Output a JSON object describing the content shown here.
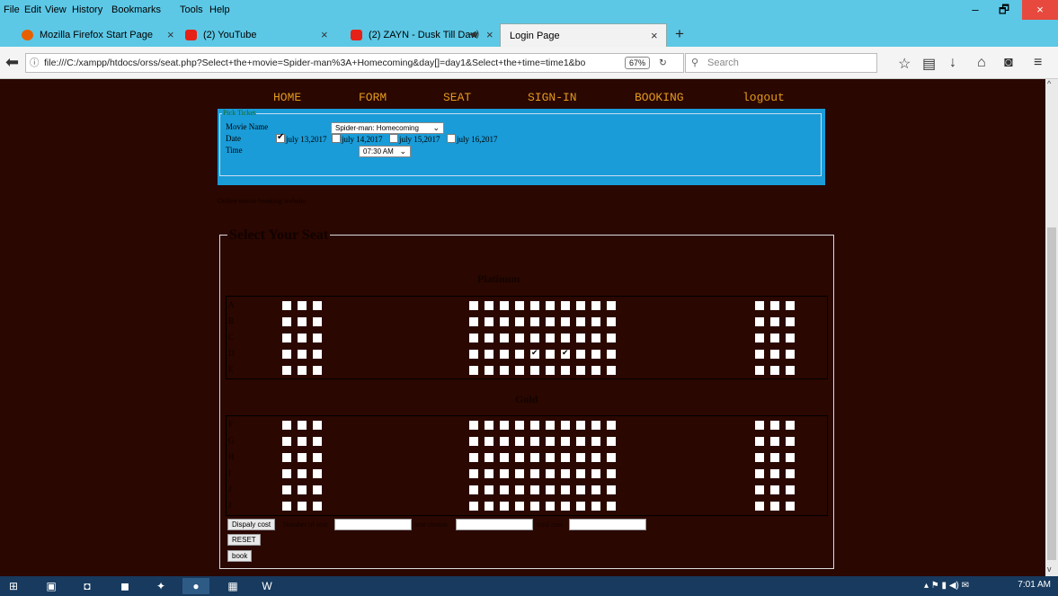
{
  "menu": [
    "File",
    "Edit",
    "View",
    "History",
    "Bookmarks",
    "Tools",
    "Help"
  ],
  "tabs": [
    {
      "label": "Mozilla Firefox Start Page"
    },
    {
      "label": "(2) YouTube"
    },
    {
      "label": "(2) ZAYN - Dusk Till Daw"
    },
    {
      "label": "Login Page"
    }
  ],
  "window_controls": {
    "minimize": "–",
    "restore": "🗗",
    "close": "×"
  },
  "navbar": {
    "url": "file:///C:/xampp/htdocs/orss/seat.php?Select+the+movie=Spider-man%3A+Homecoming&day[]=day1&Select+the+time=time1&bo",
    "zoom": "67%",
    "search_placeholder": "Search"
  },
  "site_nav": [
    "HOME",
    "FORM",
    "SEAT",
    "SIGN-IN",
    "BOOKING",
    "logout"
  ],
  "pick": {
    "legend": "Pick Ticket",
    "movie_label": "Movie Name",
    "movie_value": "Spider-man: Homecoming",
    "date_label": "Date",
    "dates": [
      {
        "label": "july 13,2017",
        "checked": true
      },
      {
        "label": "july 14,2017",
        "checked": false
      },
      {
        "label": "july 15,2017",
        "checked": false
      },
      {
        "label": "july 16,2017",
        "checked": false
      }
    ],
    "time_label": "Time",
    "time_value": "07:30 AM"
  },
  "footer_text": "Online movie booking website",
  "seats": {
    "legend": "Select Your Seat",
    "sections": [
      {
        "title": "Platinum",
        "rows": [
          "A",
          "B",
          "C",
          "D",
          "E"
        ]
      },
      {
        "title": "Gold",
        "rows": [
          "F",
          "G",
          "H",
          "I",
          "J",
          "J"
        ]
      }
    ],
    "checked": [
      {
        "row": "D",
        "seat": 5
      },
      {
        "row": "D",
        "seat": 7
      }
    ]
  },
  "form": {
    "display_cost": "Dispaly cost",
    "num_seats_label": "Number of seat",
    "seats_chosen_label": "seat chosen",
    "total_cost_label": "total cost",
    "reset": "RESET",
    "book": "book"
  },
  "taskbar": {
    "clock": "7:01 AM"
  },
  "colors": {
    "page_bg": "#2a0700",
    "nav_text": "#e39a1e",
    "pick_bg": "#1a9cd8",
    "chrome": "#5cc8e6"
  }
}
